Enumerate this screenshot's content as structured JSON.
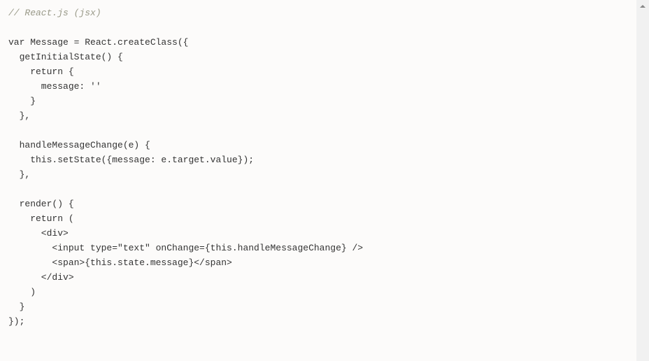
{
  "code": {
    "line1": "// React.js (jsx)",
    "line2": "",
    "line3": "var Message = React.createClass({",
    "line4": "  getInitialState() {",
    "line5": "    return {",
    "line6": "      message: ''",
    "line7": "    }",
    "line8": "  },",
    "line9": "",
    "line10": "  handleMessageChange(e) {",
    "line11": "    this.setState({message: e.target.value});",
    "line12": "  },",
    "line13": "",
    "line14": "  render() {",
    "line15": "    return (",
    "line16": "      <div>",
    "line17": "        <input type=\"text\" onChange={this.handleMessageChange} />",
    "line18": "        <span>{this.state.message}</span>",
    "line19": "      </div>",
    "line20": "    )",
    "line21": "  }",
    "line22": "});"
  }
}
